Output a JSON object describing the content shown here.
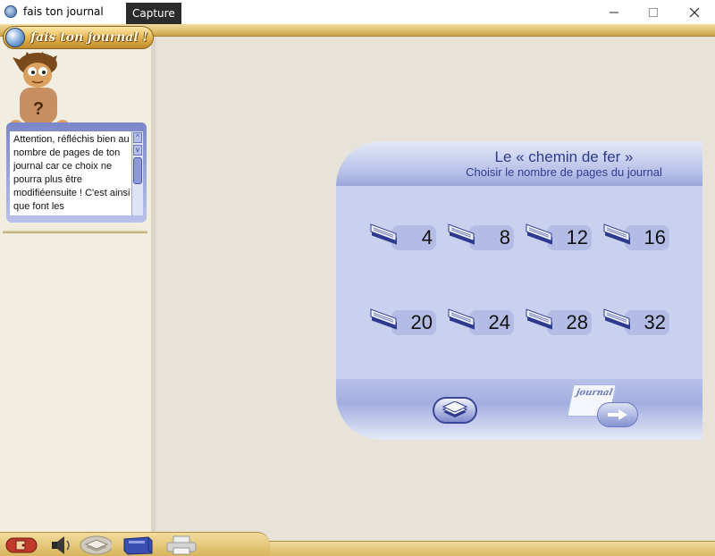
{
  "window": {
    "title": "fais ton journal",
    "tooltip": "Capture",
    "minimize_icon": "minimize-icon",
    "maximize_icon": "maximize-icon",
    "close_icon": "close-icon"
  },
  "sidebar": {
    "logo_text": "fais ton journal !",
    "character_mark": "?",
    "help_text": "Attention, réfléchis bien au nombre de pages de ton journal car ce choix ne pourra plus être modifiéensuite ! C'est ainsi que font les",
    "scroll_up_glyph": "^",
    "scroll_down_glyph": "v"
  },
  "panel": {
    "title": "Le « chemin de fer »",
    "subtitle": "Choisir le nombre de pages du journal",
    "page_options": [
      "4",
      "8",
      "12",
      "16",
      "20",
      "24",
      "28",
      "32"
    ],
    "journal_label": "journal"
  },
  "toolbar": {
    "tools": [
      "exit-icon",
      "speaker-icon",
      "pages-icon",
      "book-icon",
      "printer-icon"
    ]
  },
  "colors": {
    "panel_blue": "#c9d1ef",
    "title_blue": "#2f3b8f",
    "gold": "#d8b860"
  }
}
